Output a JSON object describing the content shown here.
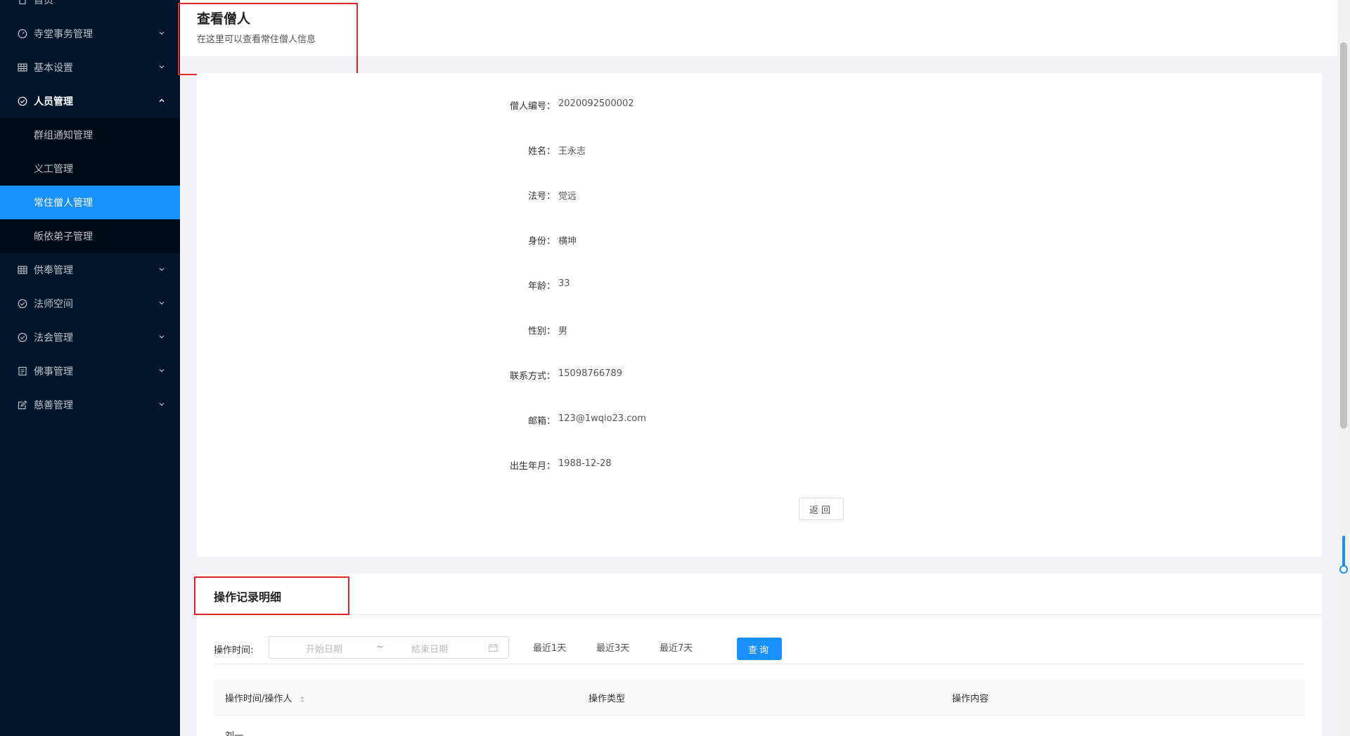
{
  "sidebar": {
    "items": [
      {
        "label": "首页",
        "icon": "home-icon"
      },
      {
        "label": "寺堂事务管理",
        "icon": "dashboard-icon"
      },
      {
        "label": "基本设置",
        "icon": "table-icon"
      },
      {
        "label": "人员管理",
        "icon": "check-circle-icon"
      },
      {
        "label": "供奉管理",
        "icon": "table-icon"
      },
      {
        "label": "法师空间",
        "icon": "check-circle-icon"
      },
      {
        "label": "法会管理",
        "icon": "check-circle-icon"
      },
      {
        "label": "佛事管理",
        "icon": "profile-icon"
      },
      {
        "label": "慈善管理",
        "icon": "edit-icon"
      }
    ],
    "sub_items": [
      {
        "label": "群组通知管理"
      },
      {
        "label": "义工管理"
      },
      {
        "label": "常住僧人管理",
        "active": true
      },
      {
        "label": "皈依弟子管理"
      }
    ]
  },
  "header": {
    "title": "查看僧人",
    "description": "在这里可以查看常住僧人信息"
  },
  "detail": {
    "fields": [
      {
        "label": "僧人编号：",
        "value": "2020092500002"
      },
      {
        "label": "姓名：",
        "value": "王永志"
      },
      {
        "label": "法号：",
        "value": "觉远"
      },
      {
        "label": "身份：",
        "value": "横坤"
      },
      {
        "label": "年龄：",
        "value": "33"
      },
      {
        "label": "性别：",
        "value": "男"
      },
      {
        "label": "联系方式：",
        "value": "15098766789"
      },
      {
        "label": "邮箱：",
        "value": "123@1wqio23.com"
      },
      {
        "label": "出生年月：",
        "value": "1988-12-28"
      }
    ],
    "back_label": "返回"
  },
  "records": {
    "title": "操作记录明细",
    "filter_label": "操作时间:",
    "start_placeholder": "开始日期",
    "separator": "~",
    "end_placeholder": "结束日期",
    "quick_ranges": [
      "最近1天",
      "最近3天",
      "最近7天"
    ],
    "query_label": "查询",
    "columns": [
      "操作时间/操作人",
      "操作类型",
      "操作内容"
    ],
    "first_row_partial": "刘一"
  },
  "colors": {
    "sidebar_bg": "#001529",
    "submenu_bg": "#000c17",
    "accent": "#1890ff",
    "annotation": "#e4262d"
  }
}
